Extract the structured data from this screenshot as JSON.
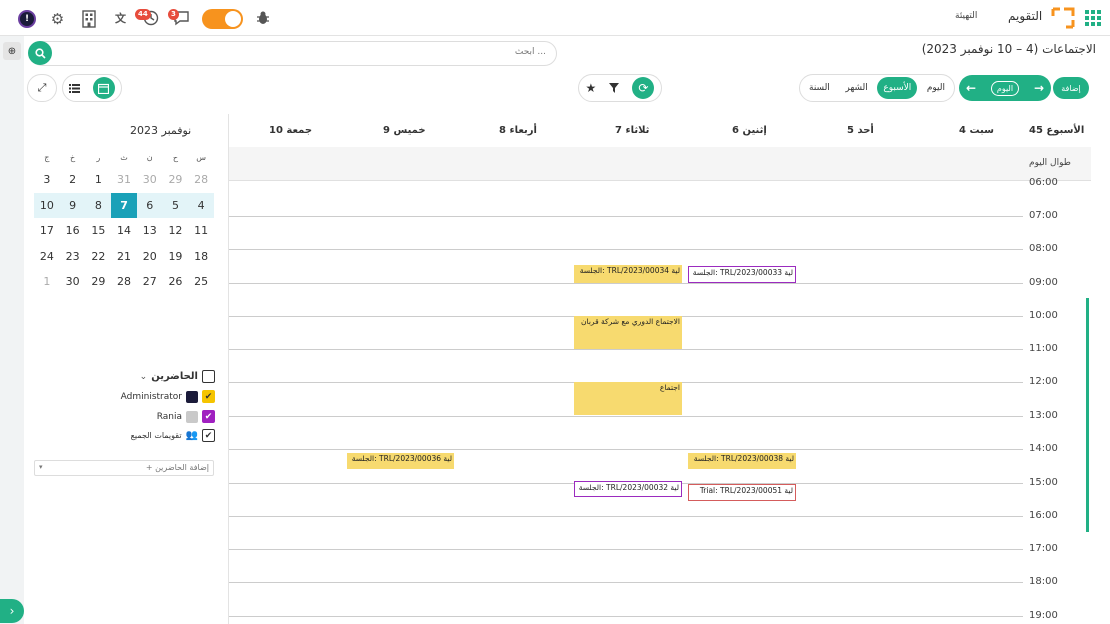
{
  "topbar": {
    "brand_app": "التقويم",
    "brand_menu": "التهيئة",
    "activity_badge": "44",
    "message_badge": "3"
  },
  "header": {
    "title": "الاجتماعات (4 – 10 نوفمبر 2023)",
    "search_placeholder": "ابحث ..."
  },
  "toolbar": {
    "add_label": "إضافة",
    "today_label": "اليوم",
    "scale_day": "اليوم",
    "scale_week": "الأسبوع",
    "scale_month": "الشهر",
    "scale_year": "السنة"
  },
  "week": {
    "number_label": "الأسبوع 45",
    "all_day_label": "طوال اليوم",
    "days": [
      "سبت 4",
      "أحد 5",
      "إثنين 6",
      "ثلاثاء 7",
      "أربعاء 8",
      "خميس 9",
      "جمعة 10"
    ],
    "hours": [
      "06:00",
      "07:00",
      "08:00",
      "09:00",
      "10:00",
      "11:00",
      "12:00",
      "13:00",
      "14:00",
      "15:00",
      "16:00",
      "17:00",
      "18:00",
      "19:00"
    ]
  },
  "events": [
    {
      "text": "لية TRL/2023/00034 :الجلسة",
      "style": "yellow"
    },
    {
      "text": "لية TRL/2023/00033 :الجلسة",
      "style": "bord"
    },
    {
      "text": "الاجتماع الدوري مع شركة قربان",
      "style": "yellow"
    },
    {
      "text": "اجتماع",
      "style": "yellow"
    },
    {
      "text": "لية TRL/2023/00036 :الجلسة",
      "style": "yellow"
    },
    {
      "text": "لية TRL/2023/00038 :الجلسة",
      "style": "yellow"
    },
    {
      "text": "لية TRL/2023/00032 :الجلسة",
      "style": "bord"
    },
    {
      "text": "لية Trial: TRL/2023/00051",
      "style": "bord2"
    }
  ],
  "mini_calendar": {
    "title": "نوفمبر 2023",
    "day_names": [
      "س",
      "ح",
      "ن",
      "ث",
      "ر",
      "خ",
      "ج"
    ],
    "weeks": [
      [
        "28",
        "29",
        "30",
        "31",
        "1",
        "2",
        "3"
      ],
      [
        "4",
        "5",
        "6",
        "7",
        "8",
        "9",
        "10"
      ],
      [
        "11",
        "12",
        "13",
        "14",
        "15",
        "16",
        "17"
      ],
      [
        "18",
        "19",
        "20",
        "21",
        "22",
        "23",
        "24"
      ],
      [
        "25",
        "26",
        "27",
        "28",
        "29",
        "30",
        "1"
      ]
    ]
  },
  "attendees": {
    "title": "الحاضرين",
    "items": [
      {
        "name": "Administrator",
        "color": "#f5c400"
      },
      {
        "name": "Rania",
        "color": "#a020c0"
      },
      {
        "name": "تقويمات الجميع",
        "color": "#ffffff"
      }
    ],
    "add_label": "+ إضافة الحاضرين"
  },
  "colors": {
    "accent": "#21b085",
    "today": "#1aa1b8",
    "event_yellow": "#f7da6f"
  }
}
